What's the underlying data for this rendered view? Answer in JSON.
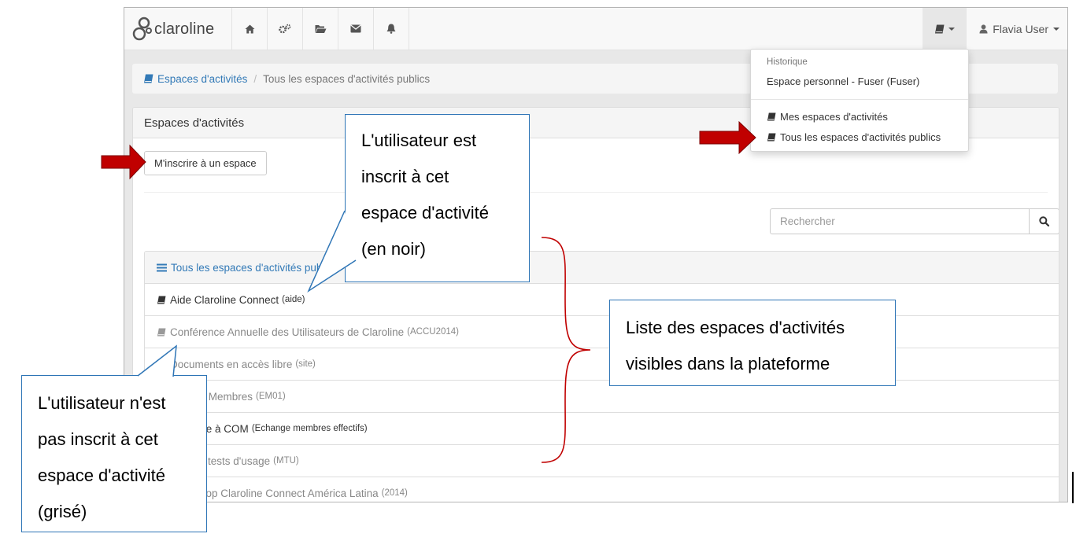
{
  "navbar": {
    "brand": "claroline",
    "icons": [
      "home-icon",
      "cogs-icon",
      "folder-open-icon",
      "envelope-icon",
      "bell-icon"
    ],
    "user_name": "Flavia User"
  },
  "breadcrumb": {
    "link": "Espaces d'activités",
    "current": "Tous les espaces d'activités publics"
  },
  "panel": {
    "title": "Espaces d'activités",
    "join_button": "M'inscrire à un espace"
  },
  "search": {
    "placeholder": "Rechercher"
  },
  "list": {
    "heading": "Tous les espaces d'activités publics",
    "items": [
      {
        "name": "Aide Claroline Connect",
        "code": "(aide)",
        "status": "enrolled"
      },
      {
        "name": "Conférence Annuelle des Utilisateurs de Claroline",
        "code": "(ACCU2014)",
        "status": "not-enrolled"
      },
      {
        "name": "Documents en accès libre",
        "code": "(site)",
        "status": "not-enrolled"
      },
      {
        "name": "Espace Membres",
        "code": "(EM01)",
        "status": "not-enrolled"
      },
      {
        "name": "Echange à COM",
        "code": "(Echange membres effectifs)",
        "status": "enrolled"
      },
      {
        "name": "Manuel tests d'usage",
        "code": "(MTU)",
        "status": "not-enrolled"
      },
      {
        "name": "Workshop Claroline Connect América Latina",
        "code": "(2014)",
        "status": "not-enrolled"
      }
    ]
  },
  "dropdown": {
    "header": "Historique",
    "history_item": "Espace personnel - Fuser (Fuser)",
    "items": [
      "Mes espaces d'activités",
      "Tous les espaces d'activités publics"
    ]
  },
  "callouts": {
    "enrolled": [
      "L'utilisateur est",
      "inscrit à cet",
      "espace d'activité",
      "(en noir)"
    ],
    "not_enrolled": [
      "L'utilisateur n'est",
      "pas inscrit à cet",
      "espace d'activité",
      "(grisé)"
    ],
    "list": [
      "Liste des espaces d'activités",
      "visibles dans la plateforme"
    ]
  },
  "colors": {
    "link": "#337ab7",
    "arrow": "#c00000",
    "callout_border": "#2e75b6",
    "greyed_text": "#888888"
  }
}
